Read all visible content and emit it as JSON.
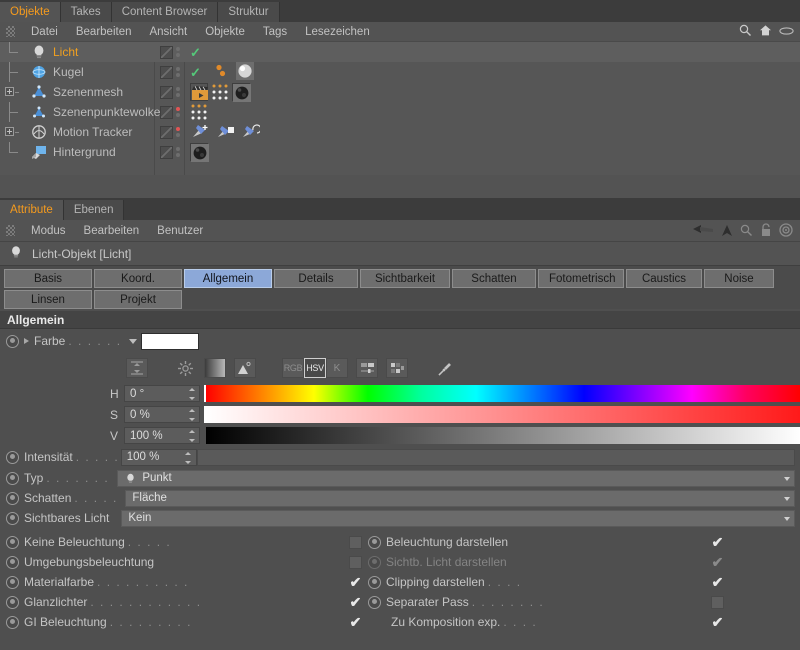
{
  "object_manager": {
    "tabs": [
      {
        "label": "Objekte",
        "active": true
      },
      {
        "label": "Takes",
        "active": false
      },
      {
        "label": "Content Browser",
        "active": false
      },
      {
        "label": "Struktur",
        "active": false
      }
    ],
    "menu": [
      "Datei",
      "Bearbeiten",
      "Ansicht",
      "Objekte",
      "Tags",
      "Lesezeichen"
    ],
    "icons": [
      "search-icon",
      "home-icon",
      "eye-icon"
    ],
    "tree": [
      {
        "label": "Licht",
        "icon": "light-bulb-icon",
        "selected": true,
        "expandable": false,
        "dot": "gray",
        "check": true,
        "tags": []
      },
      {
        "label": "Kugel",
        "icon": "sphere-icon",
        "selected": false,
        "expandable": false,
        "dot": "gray",
        "check": true,
        "tags": [
          "vertex-map-icon",
          "material-sphere-icon"
        ]
      },
      {
        "label": "Szenenmesh",
        "icon": "mesh-icon",
        "selected": false,
        "expandable": true,
        "dot": "gray",
        "check": false,
        "tags": [
          "motion-clapper-icon",
          "point-grid-icon",
          "texture-sphere-icon"
        ]
      },
      {
        "label": "Szenenpunktewolke",
        "icon": "mesh-icon",
        "selected": false,
        "expandable": false,
        "dot": "red",
        "check": false,
        "tags": [
          "point-grid-icon"
        ]
      },
      {
        "label": "Motion Tracker",
        "icon": "tracker-icon",
        "selected": false,
        "expandable": true,
        "dot": "red",
        "check": false,
        "tags": [
          "pin-add-icon",
          "pin-square-icon",
          "pin-rotate-icon"
        ]
      },
      {
        "label": "Hintergrund",
        "icon": "background-icon",
        "selected": false,
        "expandable": false,
        "dot": "gray",
        "check": false,
        "tags": [
          "texture-sphere-icon"
        ]
      }
    ]
  },
  "attribute_manager": {
    "tabs": [
      {
        "label": "Attribute",
        "active": true
      },
      {
        "label": "Ebenen",
        "active": false
      }
    ],
    "menu": [
      "Modus",
      "Bearbeiten",
      "Benutzer"
    ],
    "icons": [
      "back-arrow-icon",
      "up-arrow-icon",
      "search-icon",
      "lock-icon",
      "target-icon"
    ],
    "object_title": "Licht-Objekt [Licht]",
    "object_icon": "light-bulb-icon",
    "property_tabs_row1": [
      {
        "label": "Basis",
        "active": false
      },
      {
        "label": "Koord.",
        "active": false
      },
      {
        "label": "Allgemein",
        "active": true
      },
      {
        "label": "Details",
        "active": false
      },
      {
        "label": "Sichtbarkeit",
        "active": false
      },
      {
        "label": "Schatten",
        "active": false
      },
      {
        "label": "Fotometrisch",
        "active": false
      },
      {
        "label": "Caustics",
        "active": false
      },
      {
        "label": "Noise",
        "active": false
      }
    ],
    "property_tabs_row2": [
      {
        "label": "Linsen",
        "active": false
      },
      {
        "label": "Projekt",
        "active": false
      }
    ],
    "section_title": "Allgemein",
    "color": {
      "label": "Farbe",
      "dots": ". . . . . . .",
      "swatch_hex": "#ffffff",
      "mode_buttons": [
        {
          "name": "range-icon",
          "label": "",
          "active": false
        },
        {
          "name": "color-wheel-icon",
          "label": "",
          "active": false
        },
        {
          "name": "gradient-icon",
          "label": "",
          "active": false
        },
        {
          "name": "picture-icon",
          "label": "",
          "active": false
        },
        {
          "name": "rgb-button",
          "label": "RGB",
          "active": false
        },
        {
          "name": "hsv-button",
          "label": "HSV",
          "active": true
        },
        {
          "name": "kelvin-button",
          "label": "K",
          "active": false
        },
        {
          "name": "mixer-icon",
          "label": "",
          "active": false
        },
        {
          "name": "swatches-icon",
          "label": "",
          "active": false
        },
        {
          "name": "eyedropper-icon",
          "label": "",
          "active": false
        }
      ],
      "channels": [
        {
          "key": "H",
          "value": "0 °"
        },
        {
          "key": "S",
          "value": "0 %"
        },
        {
          "key": "V",
          "value": "100 %"
        }
      ]
    },
    "fields": [
      {
        "name": "intensity",
        "label": "Intensität",
        "dots": ". . . . . .",
        "value": "100 %",
        "type": "slider"
      },
      {
        "name": "type",
        "label": "Typ",
        "dots": ". . . . . . . . . . . .",
        "value": "Punkt",
        "type": "dropdown",
        "icon": "light-bulb-icon"
      },
      {
        "name": "shadow",
        "label": "Schatten",
        "dots": ". . . . . . .",
        "value": "Fläche",
        "type": "dropdown"
      },
      {
        "name": "visible-light",
        "label": "Sichtbares Licht",
        "dots": "",
        "value": "Kein",
        "type": "dropdown"
      }
    ],
    "checkboxes_left": [
      {
        "label": "Keine Beleuchtung",
        "dots": ". . . . .",
        "checked": false,
        "anim": true
      },
      {
        "label": "Umgebungsbeleuchtung",
        "dots": "",
        "checked": false,
        "anim": true
      },
      {
        "label": "Materialfarbe",
        "dots": ". . . . . . . . . .",
        "checked": true,
        "anim": true
      },
      {
        "label": "Glanzlichter",
        "dots": ". . . . . . . . . . . .",
        "checked": true,
        "anim": true
      },
      {
        "label": "GI Beleuchtung",
        "dots": ". . . . . . . . .",
        "checked": true,
        "anim": true
      }
    ],
    "checkboxes_right": [
      {
        "label": "Beleuchtung darstellen",
        "dots": "",
        "checked": true,
        "anim": true,
        "dim": false
      },
      {
        "label": "Sichtb. Licht darstellen",
        "dots": "",
        "checked": true,
        "anim": true,
        "dim": true
      },
      {
        "label": "Clipping darstellen",
        "dots": ". . . .",
        "checked": true,
        "anim": true,
        "dim": false
      },
      {
        "label": "Separater Pass",
        "dots": ". . . . . . . .",
        "checked": false,
        "anim": true,
        "dim": false
      },
      {
        "label": "Zu Komposition exp.",
        "dots": ". . . .",
        "checked": true,
        "anim": false,
        "dim": false
      }
    ]
  }
}
